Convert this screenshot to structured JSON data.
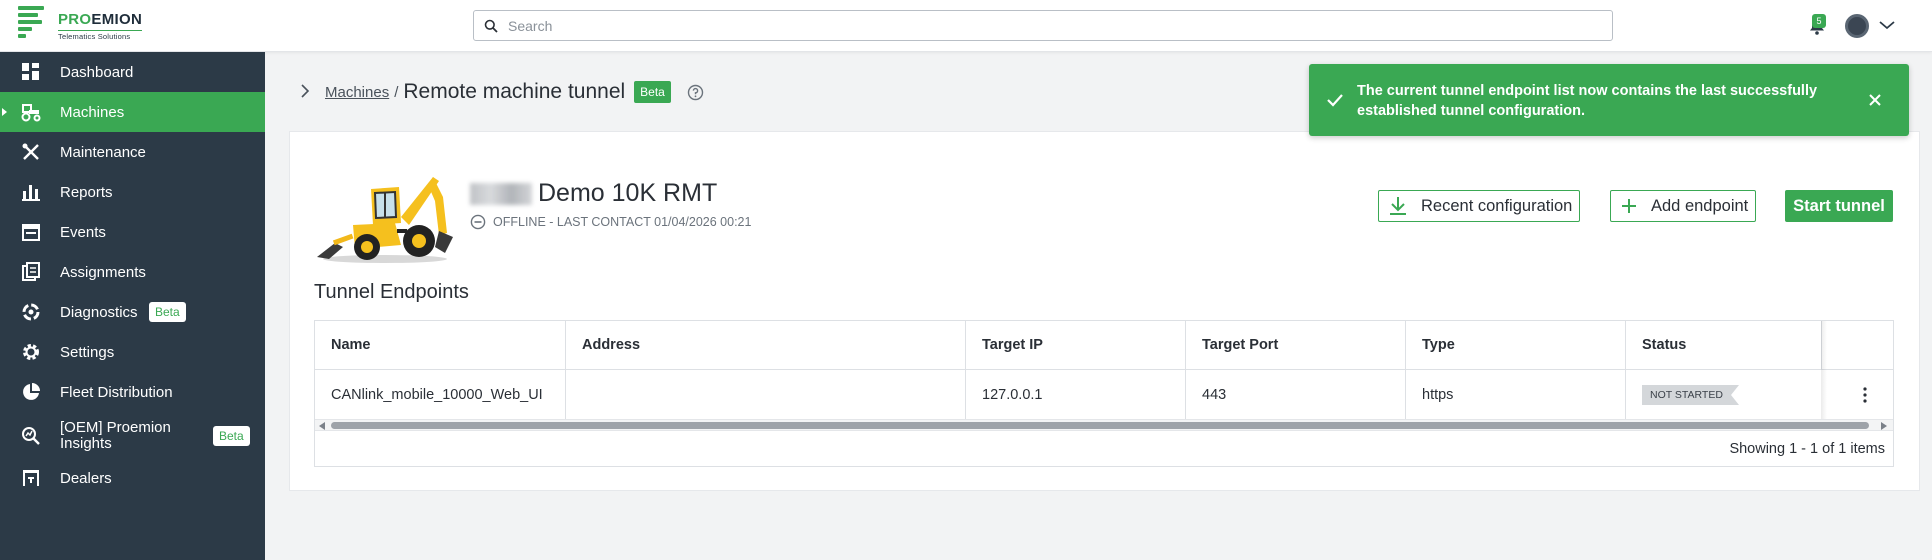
{
  "brand": {
    "name_prefix": "PRO",
    "name_suffix": "EMION",
    "tagline": "Telematics Solutions",
    "accent_color": "#3aa853",
    "sidebar_color": "#2c3a47"
  },
  "topbar": {
    "search_placeholder": "Search",
    "notification_count": "5"
  },
  "sidebar": {
    "items": [
      {
        "label": "Dashboard",
        "icon": "dashboard-icon"
      },
      {
        "label": "Machines",
        "icon": "tractor-icon",
        "active": true
      },
      {
        "label": "Maintenance",
        "icon": "tools-icon"
      },
      {
        "label": "Reports",
        "icon": "bar-chart-icon"
      },
      {
        "label": "Events",
        "icon": "calendar-icon"
      },
      {
        "label": "Assignments",
        "icon": "assignment-icon"
      },
      {
        "label": "Diagnostics",
        "icon": "diagnostics-icon",
        "badge": "Beta"
      },
      {
        "label": "Settings",
        "icon": "gear-icon"
      },
      {
        "label": "Fleet Distribution",
        "icon": "pie-chart-icon"
      },
      {
        "label": "[OEM] Proemion Insights",
        "icon": "insights-icon",
        "badge": "Beta"
      },
      {
        "label": "Dealers",
        "icon": "dealers-icon"
      }
    ]
  },
  "breadcrumb": {
    "parent": "Machines",
    "separator": "/",
    "title": "Remote machine tunnel",
    "badge": "Beta"
  },
  "toast": {
    "message": "The current tunnel endpoint list now contains the last successfully established tunnel configuration."
  },
  "machine": {
    "name": "Demo 10K RMT",
    "status": "OFFLINE - LAST CONTACT 01/04/2026 00:21"
  },
  "actions": {
    "recent_configuration": "Recent configuration",
    "add_endpoint": "Add endpoint",
    "start_tunnel": "Start tunnel"
  },
  "endpoints": {
    "title": "Tunnel Endpoints",
    "columns": [
      "Name",
      "Address",
      "Target IP",
      "Target Port",
      "Type",
      "Status"
    ],
    "rows": [
      {
        "name": "CANlink_mobile_10000_Web_UI",
        "address": "",
        "target_ip": "127.0.0.1",
        "target_port": "443",
        "type": "https",
        "status": "NOT STARTED"
      }
    ],
    "pager": "Showing 1 - 1 of 1 items"
  }
}
